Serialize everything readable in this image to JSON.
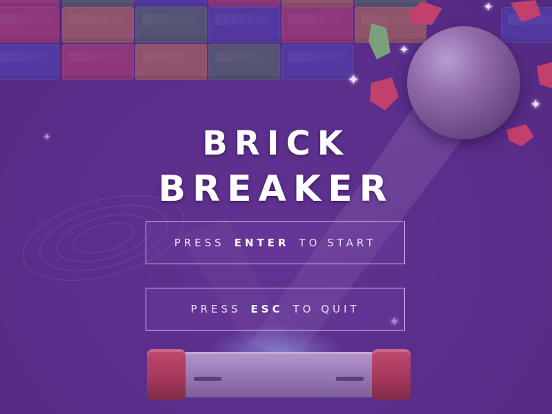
{
  "game": {
    "title_line1": "BRICK",
    "title_line2": "BREAKER"
  },
  "menu": {
    "start": {
      "prefix": "PRESS",
      "key": "ENTER",
      "suffix": "TO START"
    },
    "quit": {
      "prefix": "PRESS",
      "key": "ESC",
      "suffix": "TO QUIT"
    }
  },
  "colors": {
    "background": "#5a2f88",
    "brick_pink": "#c2406c",
    "brick_orange": "#c77a4a",
    "brick_green": "#4e7a5b",
    "brick_blue": "#4b46b8",
    "paddle_cap": "#a3385b",
    "paddle_body": "#9a7ab4",
    "ball": "#8f6aa9"
  },
  "icons": {
    "ball": "ball-icon",
    "paddle": "paddle-icon",
    "sparkle": "sparkle-icon"
  }
}
